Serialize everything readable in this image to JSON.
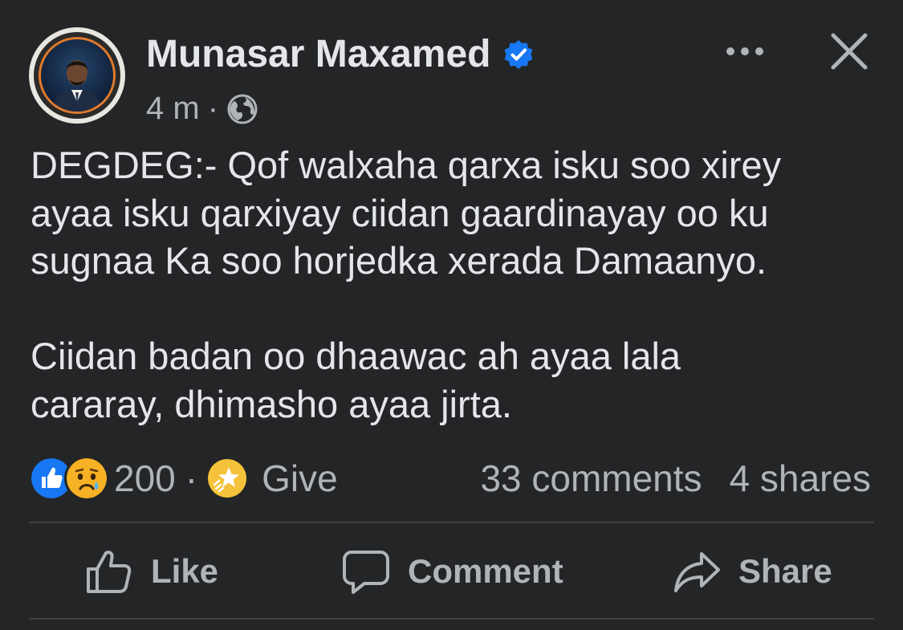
{
  "post": {
    "author": "Munasar Maxamed",
    "verified": true,
    "time": "4 m",
    "separator": "·",
    "audience_icon": "globe-icon",
    "paragraphs": [
      "DEGDEG:- Qof walxaha qarxa isku soo xirey\nayaa isku qarxiyay ciidan gaardinayay oo ku\nsugnaa Ka soo horjedka xerada Damaanyo.",
      "Ciidan badan oo dhaawac ah ayaa lala\ncararay, dhimasho ayaa jirta."
    ]
  },
  "reactions": {
    "icons": [
      "like-reaction-icon",
      "sad-reaction-icon"
    ],
    "count": "200",
    "give_label": "Give",
    "comments": "33 comments",
    "shares": "4 shares"
  },
  "actions": {
    "like": "Like",
    "comment": "Comment",
    "share": "Share"
  },
  "colors": {
    "background": "#242526",
    "text": "#e4e6eb",
    "secondary_text": "#b0b3b8",
    "verified_blue": "#1877f2",
    "like_blue": "#1877f2",
    "sad_yellow": "#f7b125",
    "give_yellow": "#f5c33b",
    "divider": "#3e4042",
    "avatar_ring_orange": "#e07a2c"
  }
}
